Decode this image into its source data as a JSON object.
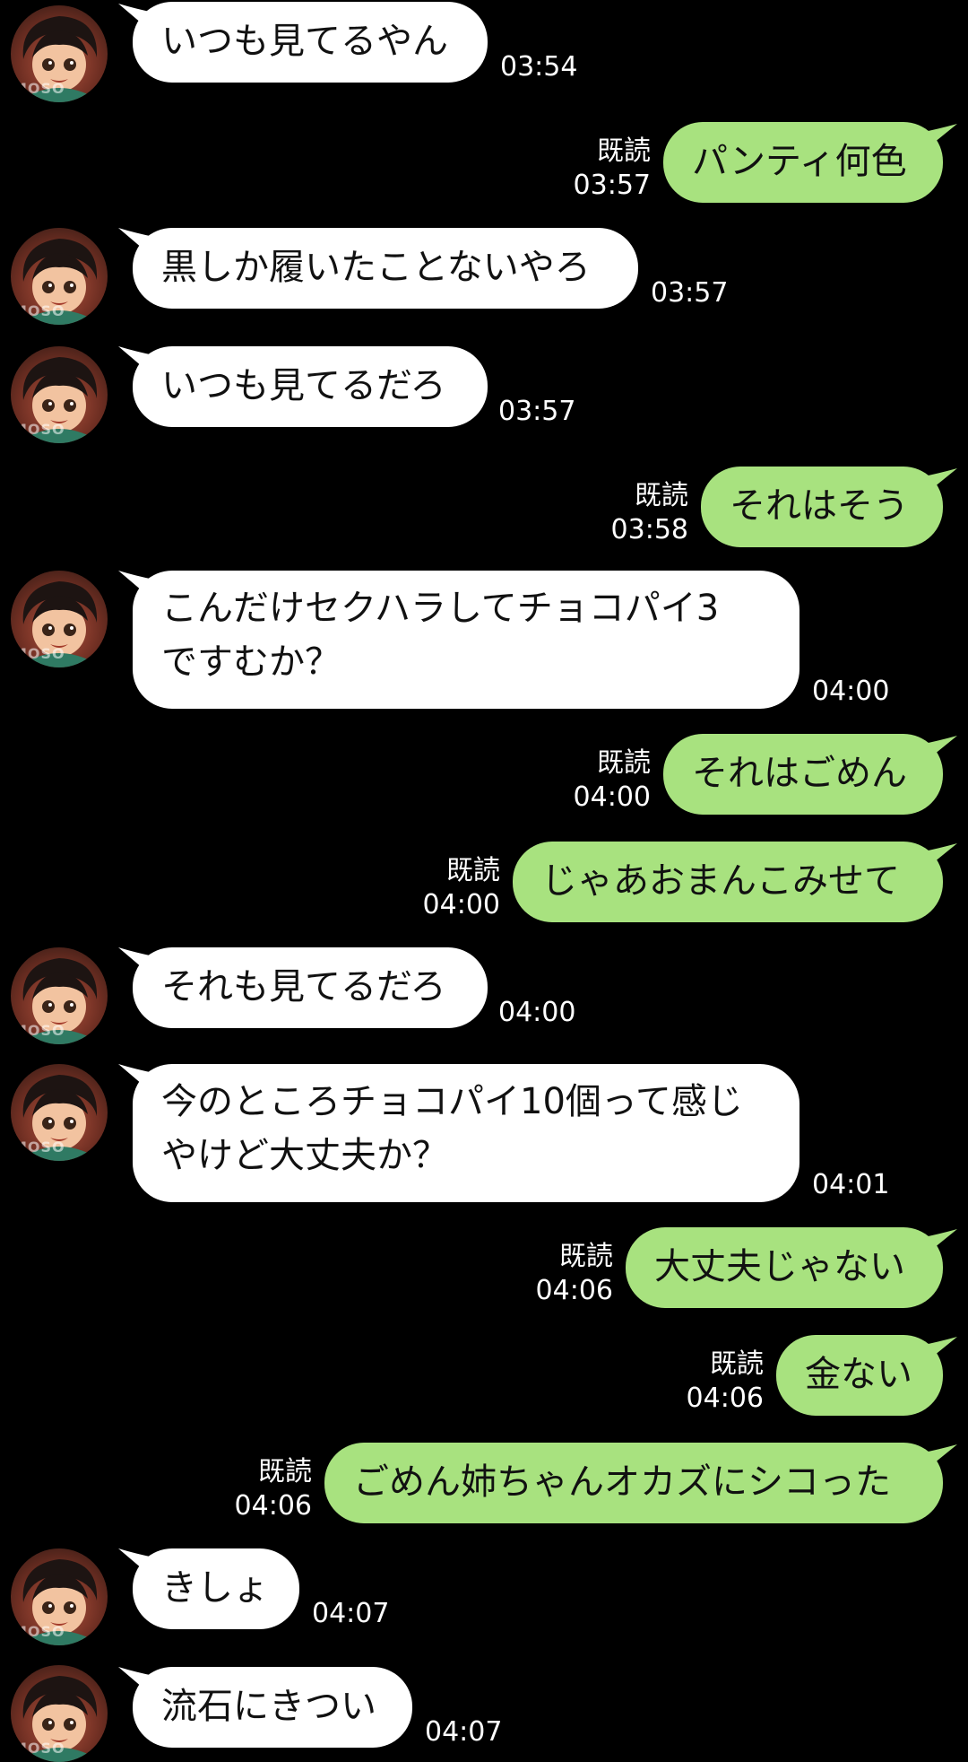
{
  "messages": [
    {
      "dir": "in",
      "text": "いつも見てるやん",
      "time": "03:54"
    },
    {
      "dir": "out",
      "text": "パンティ何色",
      "read": "既読",
      "time": "03:57"
    },
    {
      "dir": "in",
      "text": "黒しか履いたことないやろ",
      "time": "03:57"
    },
    {
      "dir": "in",
      "text": "いつも見てるだろ",
      "time": "03:57"
    },
    {
      "dir": "out",
      "text": "それはそう",
      "read": "既読",
      "time": "03:58"
    },
    {
      "dir": "in",
      "lines": [
        "こんだけセクハラしてチョコパイ3",
        "ですむか？"
      ],
      "time": "04:00"
    },
    {
      "dir": "out",
      "text": "それはごめん",
      "read": "既読",
      "time": "04:00"
    },
    {
      "dir": "out",
      "text": "じゃあおまんこみせて",
      "read": "既読",
      "time": "04:00"
    },
    {
      "dir": "in",
      "text": "それも見てるだろ",
      "time": "04:00"
    },
    {
      "dir": "in",
      "lines": [
        "今のところチョコパイ10個って感じ",
        "やけど大丈夫か？"
      ],
      "time": "04:01"
    },
    {
      "dir": "out",
      "text": "大丈夫じゃない",
      "read": "既読",
      "time": "04:06"
    },
    {
      "dir": "out",
      "text": "金ない",
      "read": "既読",
      "time": "04:06"
    },
    {
      "dir": "out",
      "text": "ごめん姉ちゃんオカズにシコった",
      "read": "既読",
      "time": "04:06"
    },
    {
      "dir": "in",
      "text": "きしょ",
      "time": "04:07"
    },
    {
      "dir": "in",
      "text": "流石にきつい",
      "time": "04:07"
    }
  ],
  "avatar": {
    "watermark": "MOSO",
    "icon": "cartoon-girl-avatar"
  },
  "colors": {
    "background": "#000000",
    "incoming_bubble": "#ffffff",
    "outgoing_bubble": "#a8e27f",
    "meta_text": "#ffffff"
  }
}
